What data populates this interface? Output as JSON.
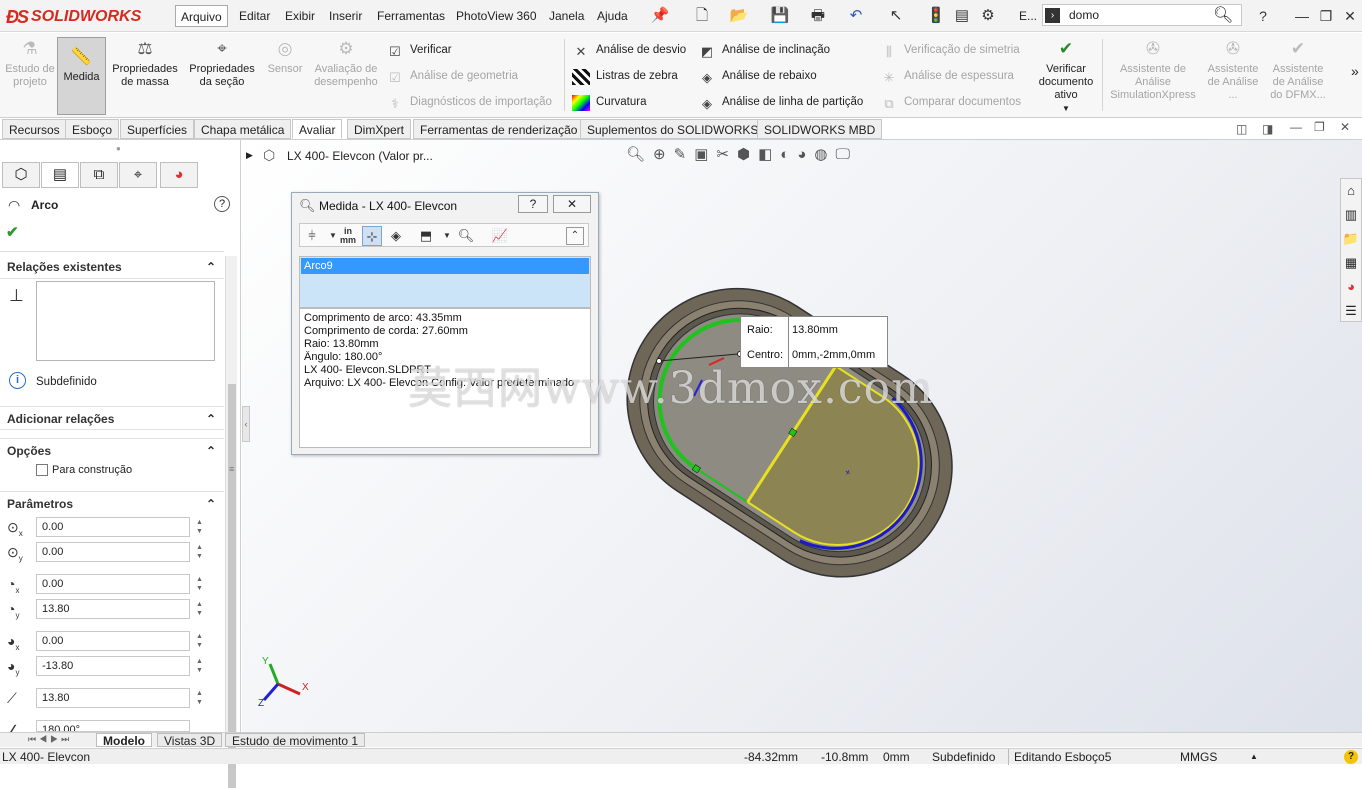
{
  "app": {
    "logo_text": "SOLIDWORKS",
    "brand_color": "#d52b1e"
  },
  "menubar": {
    "items": [
      "Arquivo",
      "Editar",
      "Exibir",
      "Inserir",
      "Ferramentas",
      "PhotoView 360",
      "Janela",
      "Ajuda"
    ],
    "active": "Arquivo",
    "overflow_label": "E...",
    "search_value": "domo",
    "help_label": "?"
  },
  "ribbon": {
    "big": [
      {
        "label": "Estudo de projeto",
        "icon": "design-study-icon",
        "enabled": false
      },
      {
        "label": "Medida",
        "icon": "measure-icon",
        "enabled": true,
        "selected": true
      },
      {
        "label": "Propriedades de massa",
        "icon": "mass-properties-icon",
        "enabled": true
      },
      {
        "label": "Propriedades da seção",
        "icon": "section-properties-icon",
        "enabled": true
      },
      {
        "label": "Sensor",
        "icon": "sensor-icon",
        "enabled": false
      },
      {
        "label": "Avaliação de desempenho",
        "icon": "performance-evaluation-icon",
        "enabled": false
      }
    ],
    "small_col1": [
      {
        "label": "Verificar",
        "icon": "check-icon",
        "enabled": true
      },
      {
        "label": "Análise de geometria",
        "icon": "geometry-analysis-icon",
        "enabled": false
      },
      {
        "label": "Diagnósticos de importação",
        "icon": "import-diagnostics-icon",
        "enabled": false
      }
    ],
    "small_col2": [
      {
        "label": "Análise de desvio",
        "icon": "deviation-analysis-icon",
        "enabled": true
      },
      {
        "label": "Listras de zebra",
        "icon": "zebra-stripes-icon",
        "enabled": true
      },
      {
        "label": "Curvatura",
        "icon": "curvature-icon",
        "enabled": true
      }
    ],
    "small_col3": [
      {
        "label": "Análise de inclinação",
        "icon": "draft-analysis-icon",
        "enabled": true
      },
      {
        "label": "Análise de rebaixo",
        "icon": "undercut-analysis-icon",
        "enabled": true
      },
      {
        "label": "Análise de linha de partição",
        "icon": "parting-line-analysis-icon",
        "enabled": true
      }
    ],
    "small_col4": [
      {
        "label": "Verificação de simetria",
        "icon": "symmetry-check-icon",
        "enabled": false
      },
      {
        "label": "Análise de espessura",
        "icon": "thickness-analysis-icon",
        "enabled": false
      },
      {
        "label": "Comparar documentos",
        "icon": "compare-documents-icon",
        "enabled": false
      }
    ],
    "check_doc": {
      "label": "Verificar documento ativo",
      "icon": "check-document-icon"
    },
    "assistants": [
      {
        "label": "Assistente de Análise SimulationXpress",
        "icon": "simulationxpress-icon"
      },
      {
        "label": "Assistente de Análise ...",
        "icon": "floxpress-icon"
      },
      {
        "label": "Assistente de Análise do DFMX...",
        "icon": "dfmxpress-icon"
      }
    ],
    "more": "»"
  },
  "command_tabs": [
    "Recursos",
    "Esboço",
    "Superfícies",
    "Chapa metálica",
    "Avaliar",
    "DimXpert",
    "Ferramentas de renderização",
    "Suplementos do SOLIDWORKS",
    "SOLIDWORKS MBD"
  ],
  "command_tabs_active": "Avaliar",
  "property_manager": {
    "title": "Arco",
    "relations_header": "Relações existentes",
    "status": "Subdefinido",
    "add_relations_header": "Adicionar relações",
    "options_header": "Opções",
    "construction_label": "Para construção",
    "params_header": "Parâmetros",
    "params": [
      "0.00",
      "0.00",
      "0.00",
      "13.80",
      "0.00",
      "-13.80",
      "13.80",
      "180.00°"
    ]
  },
  "tree": {
    "part_label": "LX 400- Elevcon  (Valor pr..."
  },
  "measure_dialog": {
    "title": "Medida - LX 400- Elevcon",
    "units_label_top": "in",
    "units_label_bottom": "mm",
    "selection": "Arco9",
    "results": [
      "Comprimento de arco: 43.35mm",
      "Comprimento de corda: 27.60mm",
      "Raio: 13.80mm",
      "Ângulo: 180.00°",
      "LX 400- Elevcon.SLDPRT",
      "Arquivo: LX 400- Elevcon Config: Valor predeterminado"
    ]
  },
  "callout": {
    "raio_label": "Raio:",
    "raio_value": "13.80mm",
    "centro_label": "Centro:",
    "centro_value": "0mm,-2mm,0mm"
  },
  "watermark": "莫西网www.3dmox.com",
  "triad": {
    "x": "X",
    "y": "Y",
    "z": "Z"
  },
  "bottom_tabs": [
    "Modelo",
    "Vistas 3D",
    "Estudo de movimento 1"
  ],
  "bottom_tabs_active": "Modelo",
  "status": {
    "file": "LX 400- Elevcon",
    "x": "-84.32mm",
    "y": "-10.8mm",
    "z": "0mm",
    "state": "Subdefinido",
    "editing": "Editando Esboço5",
    "units": "MMGS"
  },
  "colors": {
    "sketch_green": "#1ec31e",
    "sketch_blue": "#1a1ac8",
    "sketch_yellow": "#e8e020",
    "face_olive": "#8c8553",
    "face_gray": "#8a8a8a"
  }
}
